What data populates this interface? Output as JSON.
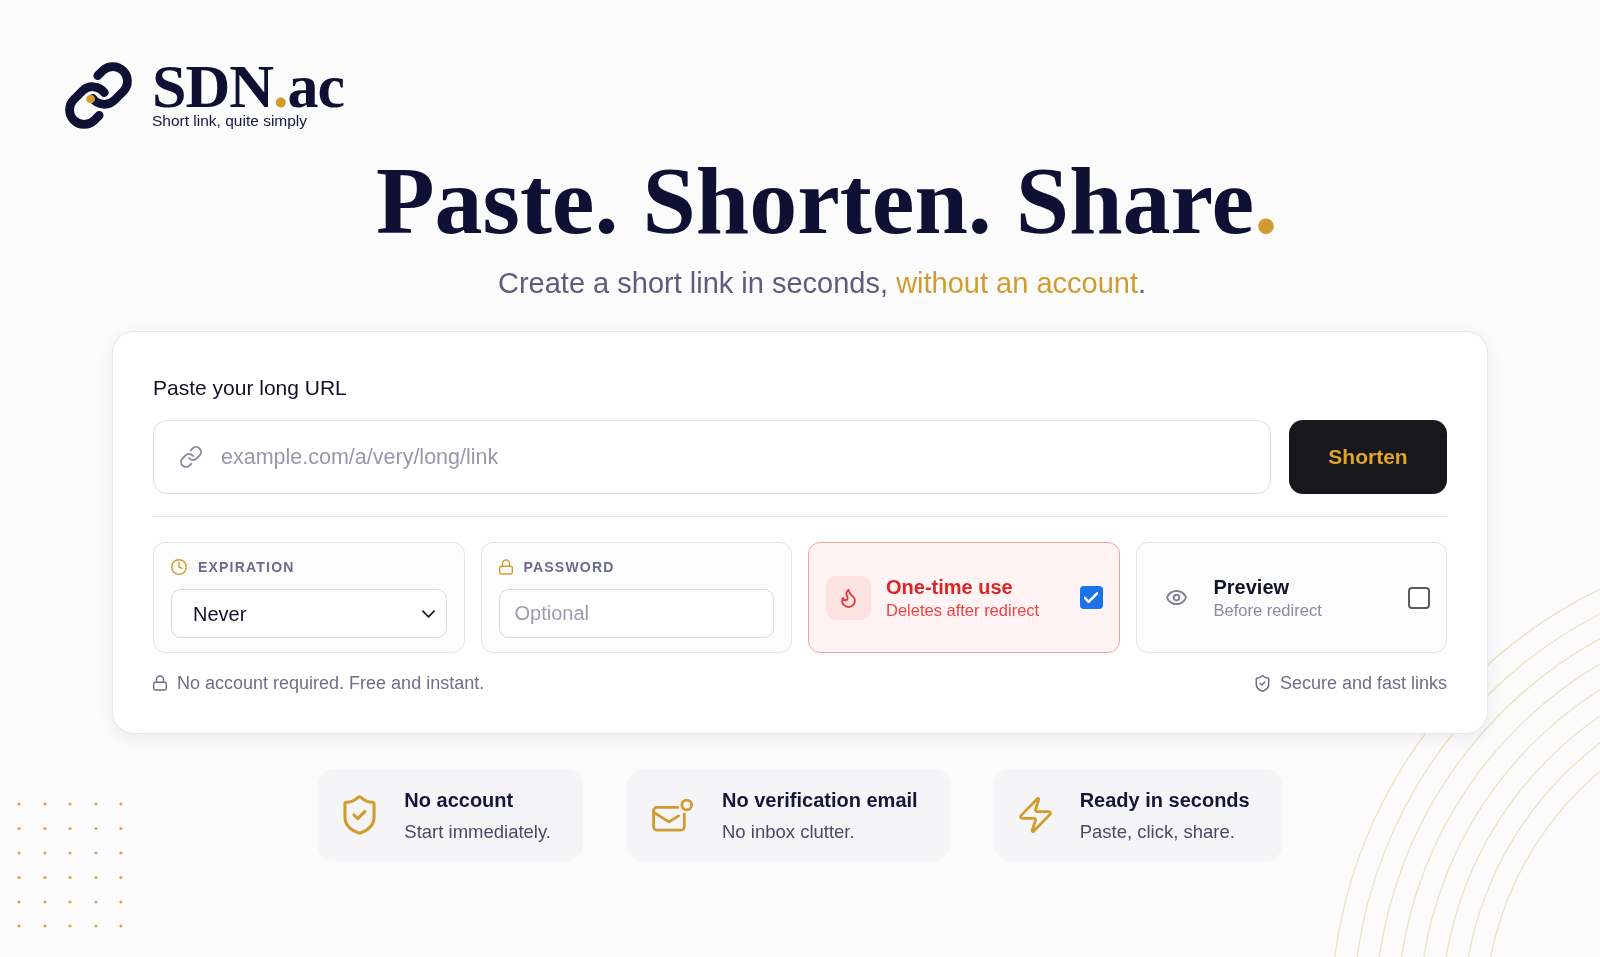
{
  "brand": {
    "name": [
      {
        "text": "SDN",
        "accent": false
      },
      {
        "text": ".",
        "accent": true
      },
      {
        "text": "ac",
        "accent": false
      }
    ],
    "tagline": "Short link, quite simply"
  },
  "hero": {
    "headline": [
      {
        "text": "Paste. Shorten. Share",
        "accent": false
      },
      {
        "text": ".",
        "accent": true
      }
    ],
    "subtitle": [
      {
        "text": "Create a short link in seconds, ",
        "accent": false
      },
      {
        "text": "without an account",
        "accent": true
      },
      {
        "text": ".",
        "accent": false
      }
    ]
  },
  "form": {
    "label": "Paste your long URL",
    "url_field": {
      "placeholder": "example.com/a/very/long/link"
    },
    "submit_button": "Shorten",
    "options": [
      {
        "kind": "select",
        "label": "EXPIRATION",
        "value": "Never"
      },
      {
        "kind": "input",
        "label": "PASSWORD",
        "placeholder": "Optional"
      },
      {
        "kind": "toggle",
        "title": "One-time use",
        "subtitle": "Deletes after redirect",
        "checked": true
      },
      {
        "kind": "toggle",
        "title": "Preview",
        "subtitle": "Before redirect",
        "checked": false
      }
    ],
    "notes": [
      "No account required. Free and instant.",
      "Secure and fast links"
    ]
  },
  "features": [
    {
      "title": "No account",
      "subtitle": "Start immediately."
    },
    {
      "title": "No verification email",
      "subtitle": "No inbox clutter."
    },
    {
      "title": "Ready in seconds",
      "subtitle": "Paste, click, share."
    }
  ]
}
